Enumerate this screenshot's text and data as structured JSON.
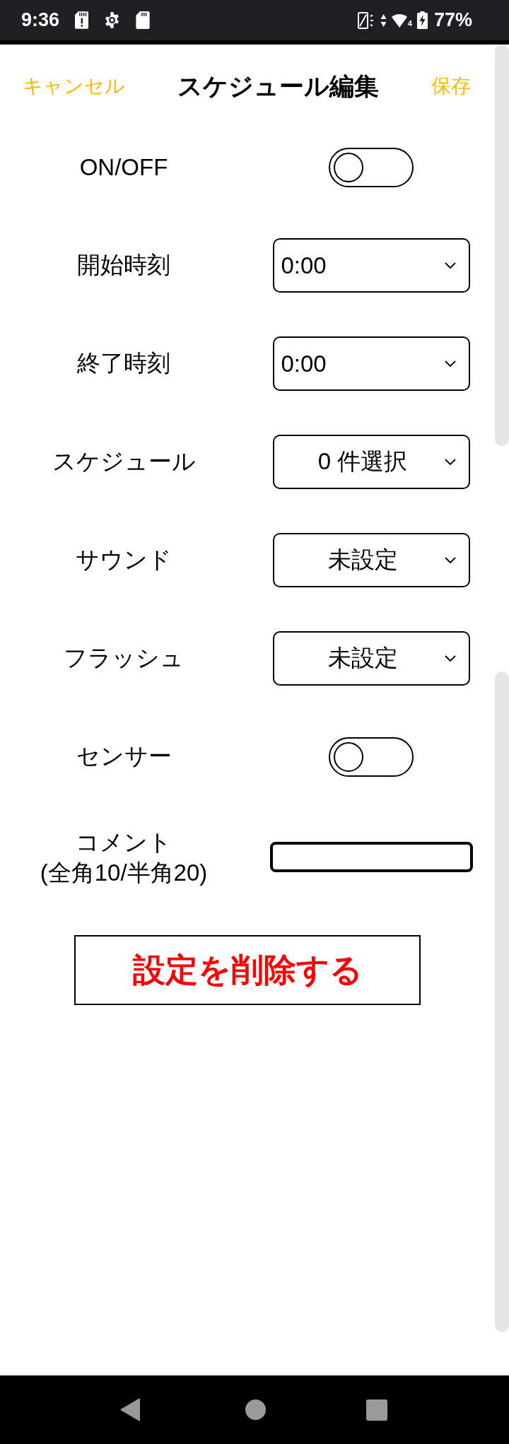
{
  "status_bar": {
    "time": "9:36",
    "wifi_badge": "4",
    "battery": "77%"
  },
  "header": {
    "cancel": "キャンセル",
    "title": "スケジュール編集",
    "save": "保存"
  },
  "rows": [
    {
      "label": "ON/OFF",
      "kind": "toggle",
      "on": false
    },
    {
      "label": "開始時刻",
      "kind": "time-select",
      "value": "0:00"
    },
    {
      "label": "終了時刻",
      "kind": "time-select",
      "value": "0:00"
    },
    {
      "label": "スケジュール",
      "kind": "select",
      "value": "0 件選択"
    },
    {
      "label": "サウンド",
      "kind": "select",
      "value": "未設定"
    },
    {
      "label": "フラッシュ",
      "kind": "select",
      "value": "未設定"
    },
    {
      "label": "センサー",
      "kind": "toggle",
      "on": false
    },
    {
      "label": "コメント",
      "note": "(全角10/半角20)",
      "kind": "text-input"
    }
  ],
  "delete_button": "設定を削除する"
}
